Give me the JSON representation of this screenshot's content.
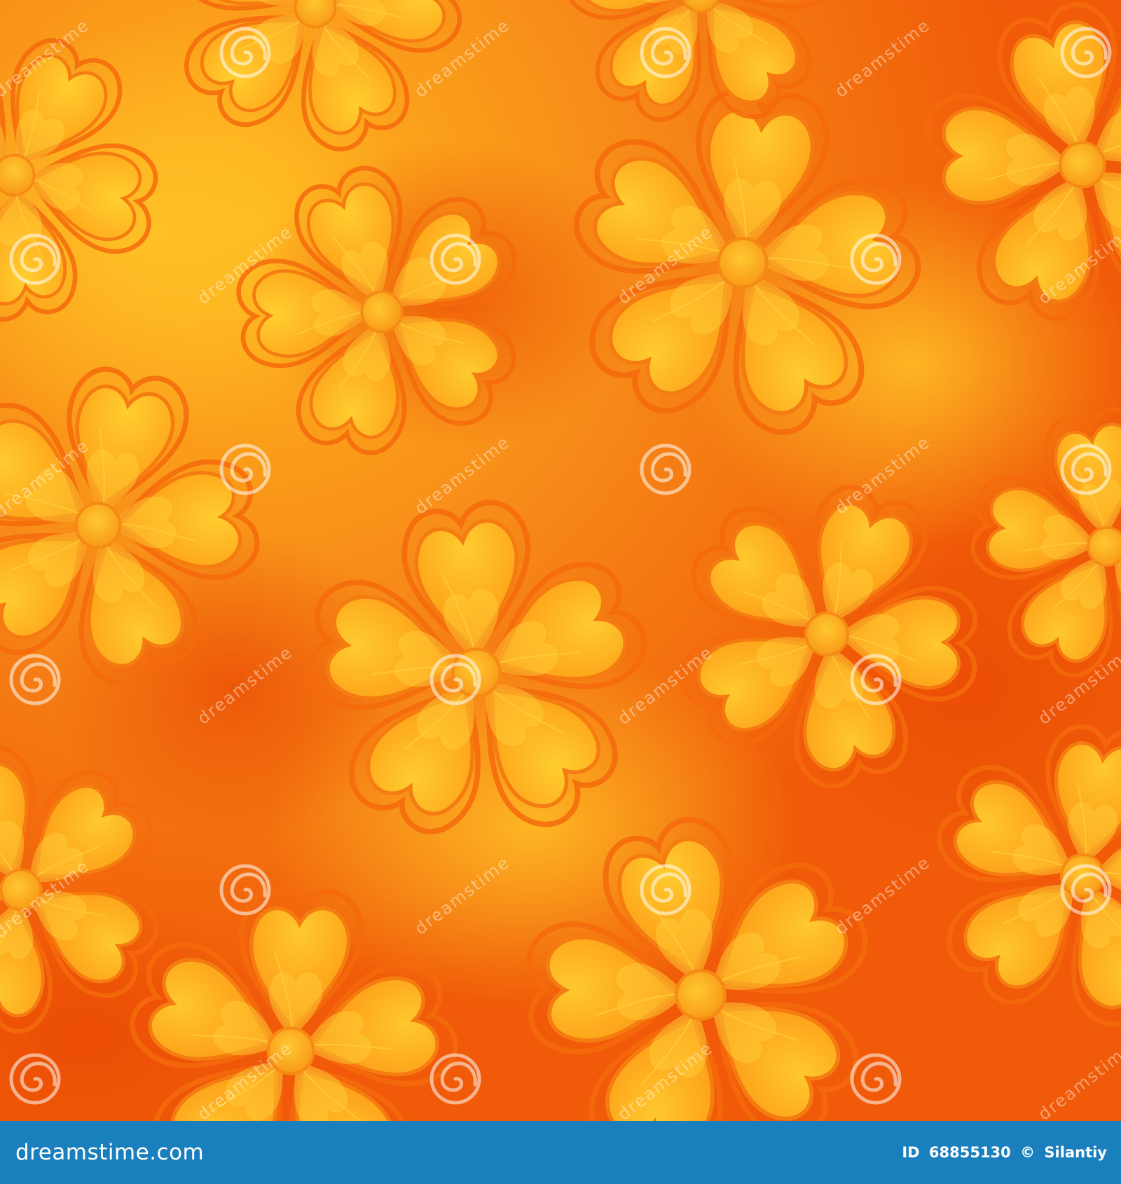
{
  "image": {
    "subject": "seamless floral pattern",
    "palette": {
      "background_deep": "#f05a08",
      "background_mid": "#f7871a",
      "background_light": "#ffc020",
      "petal_fill": "#ffae1c",
      "petal_highlight": "#ffd030",
      "petal_outline": "#f46a0c",
      "watermark": "#ffffff"
    },
    "watermark_text": "dreamstime"
  },
  "footer": {
    "site": "dreamstime.com",
    "id_label": "ID",
    "id_value": "68855130",
    "copyright_symbol": "©",
    "author": "Silantiy",
    "background": "#1a7fbd"
  }
}
